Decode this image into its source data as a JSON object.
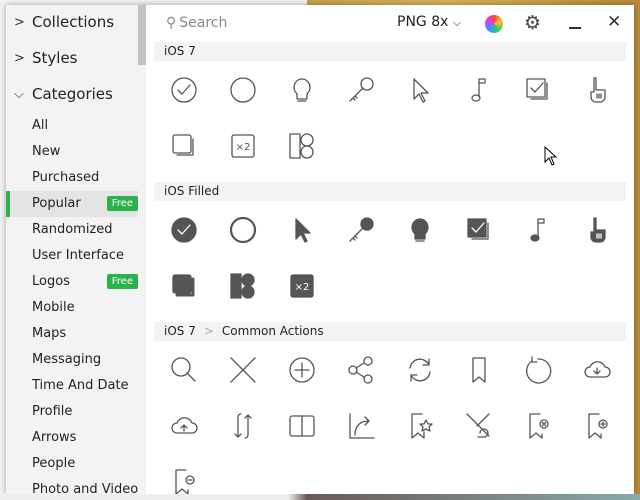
{
  "sidebar": {
    "groups": [
      {
        "label": "Collections",
        "expanded": false
      },
      {
        "label": "Styles",
        "expanded": false
      },
      {
        "label": "Categories",
        "expanded": true
      }
    ],
    "items": [
      {
        "label": "All"
      },
      {
        "label": "New"
      },
      {
        "label": "Purchased"
      },
      {
        "label": "Popular",
        "selected": true,
        "badge": "Free"
      },
      {
        "label": "Randomized"
      },
      {
        "label": "User Interface"
      },
      {
        "label": "Logos",
        "badge": "Free"
      },
      {
        "label": "Mobile"
      },
      {
        "label": "Maps"
      },
      {
        "label": "Messaging"
      },
      {
        "label": "Time And Date"
      },
      {
        "label": "Profile"
      },
      {
        "label": "Arrows"
      },
      {
        "label": "People"
      },
      {
        "label": "Photo and Video"
      }
    ]
  },
  "toolbar": {
    "search_placeholder": "Search",
    "format": "PNG 8x",
    "close": "✕",
    "gear": "⚙"
  },
  "colors": {
    "accent": "#2bb24c",
    "icon": "#555555"
  },
  "sections": [
    {
      "title": "iOS 7",
      "icons": [
        "checkmark-circle",
        "circle",
        "lightbulb",
        "key",
        "cursor",
        "music-note",
        "checkbox-stack",
        "hand-pointer",
        "copy",
        "x2",
        "layout"
      ]
    },
    {
      "title": "iOS Filled",
      "icons": [
        "checkmark-circle",
        "circle",
        "cursor",
        "key",
        "lightbulb",
        "checkbox-stack",
        "music-note",
        "hand-pointer",
        "copy",
        "layout",
        "x2"
      ],
      "filled": true
    },
    {
      "title": "iOS 7",
      "subtitle": "Common Actions",
      "icons": [
        "search",
        "close",
        "add-circle",
        "share",
        "refresh",
        "bookmark",
        "rotate",
        "cloud-download",
        "cloud-upload",
        "sync",
        "book",
        "share-arrow",
        "bookmark-star",
        "shuffle",
        "bookmark-remove",
        "bookmark-add",
        "bookmark-minus"
      ]
    }
  ]
}
